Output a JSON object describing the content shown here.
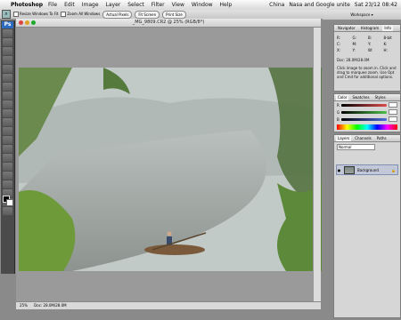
{
  "menu": {
    "apple": "",
    "app": "Photoshop",
    "items": [
      "File",
      "Edit",
      "Image",
      "Layer",
      "Select",
      "Filter",
      "View",
      "Window",
      "Help"
    ],
    "status_location": "China",
    "status_message": "Nasa and Google unite",
    "status_time": "Sat 23/12 08:42"
  },
  "options": {
    "resize_windows": "Resize Windows To Fit",
    "zoom_all_windows": "Zoom All Windows",
    "actual_pixels": "Actual Pixels",
    "fit_screen": "Fit Screen",
    "print_size": "Print Size"
  },
  "workspace": {
    "label": "Workspace"
  },
  "toolbox": {
    "logo": "Ps"
  },
  "document": {
    "title": "_MG_9809.CR2 @ 25% (RGB/8*)",
    "status": "25%",
    "doc_size": "Doc: 28.0M/28.0M"
  },
  "navigator": {
    "tabs": [
      "Navigator",
      "Histogram",
      "Info"
    ],
    "values": [
      "R:",
      "G:",
      "B:",
      "8-bit",
      "C:",
      "M:",
      "Y:",
      "K:",
      "X:",
      "Y:",
      "W:",
      "H:"
    ],
    "doc": "Doc: 28.0M/28.0M",
    "help_text": "Click image to zoom in. Click and drag to marquee zoom. Use Opt and Cmd for additional options."
  },
  "color_panel": {
    "tabs": [
      "Color",
      "Swatches",
      "Styles"
    ],
    "channels": [
      "R",
      "G",
      "B"
    ],
    "slider_colors": [
      "#e04c4c",
      "#4cc04c",
      "#4c6ce0"
    ]
  },
  "layers": {
    "tabs": [
      "Layers",
      "Channels",
      "Paths"
    ],
    "blend_mode": "Normal",
    "layer_name": "Background"
  },
  "accent": "#2d6bc0"
}
